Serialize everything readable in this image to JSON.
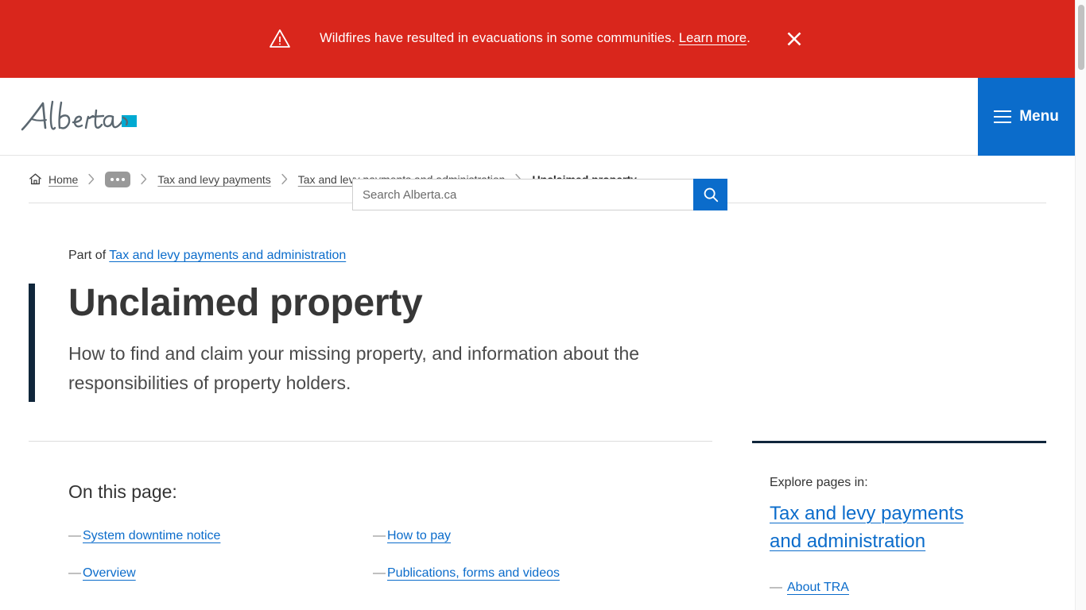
{
  "alert": {
    "icon": "warning-triangle-icon",
    "message": "Wildfires have resulted in evacuations in some communities.",
    "link_label": "Learn more",
    "link_suffix": ".",
    "close_label": "✕",
    "background_color": "#d9261c"
  },
  "header": {
    "logo_text": "Alberta",
    "logo_mark_color": "#00aad2",
    "logo_script_color": "#5b6770",
    "search": {
      "placeholder": "Search Alberta.ca",
      "value": "",
      "button_icon": "search-icon"
    },
    "menu": {
      "label": "Menu",
      "icon": "hamburger-icon",
      "background_color": "#0b6ccb"
    }
  },
  "breadcrumb": {
    "home_label": "Home",
    "home_icon": "home-icon",
    "ellipsis_label": "•••",
    "separator_icon": "chevron-right-icon",
    "items": [
      {
        "label": "Tax and levy payments",
        "current": false
      },
      {
        "label": "Tax and levy payments and administration",
        "current": false
      },
      {
        "label": "Unclaimed property",
        "current": true
      }
    ]
  },
  "hero": {
    "part_of_prefix": "Part of",
    "part_of_link": "Tax and levy payments and administration",
    "title": "Unclaimed property",
    "description": "How to find and claim your missing property, and information about the responsibilities of property holders.",
    "accent_color": "#10263b"
  },
  "main": {
    "on_this_page_heading": "On this page:",
    "toc": [
      {
        "label": "System downtime notice"
      },
      {
        "label": "How to pay"
      },
      {
        "label": "Overview"
      },
      {
        "label": "Publications, forms and videos"
      }
    ],
    "dash": "—"
  },
  "sidebar": {
    "explore_label": "Explore pages in:",
    "explore_link": "Tax and levy payments and administration",
    "items": [
      {
        "label": "About TRA"
      }
    ],
    "dash": "—"
  },
  "colors": {
    "brand_blue": "#0b6ccb",
    "alert_red": "#d9261c",
    "navy": "#10263b",
    "link_blue": "#0b6ccb"
  }
}
